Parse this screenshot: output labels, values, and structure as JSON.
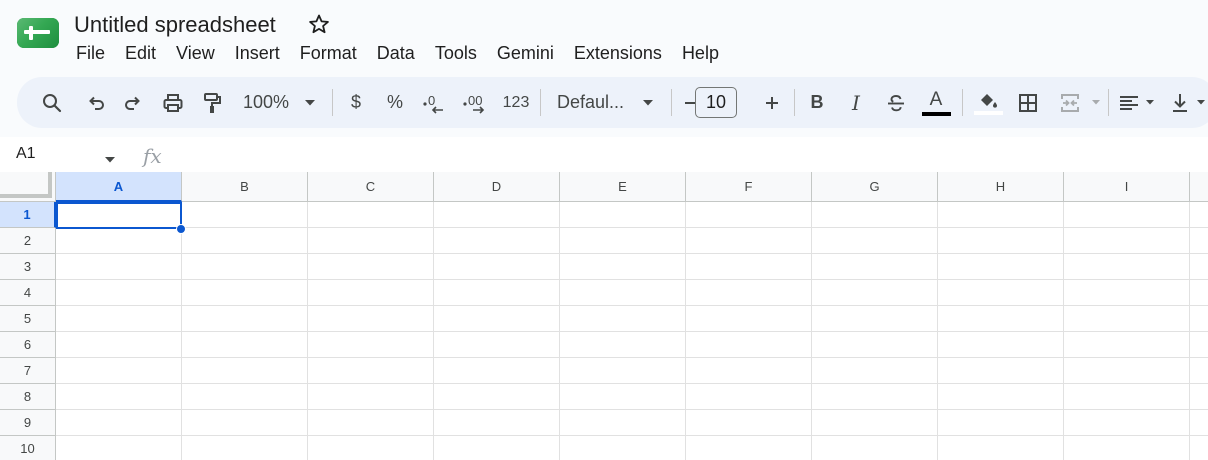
{
  "app": {
    "document_title": "Untitled spreadsheet",
    "brand_color": "#1e8e3e",
    "accent_color": "#0b57d0"
  },
  "menu": [
    "File",
    "Edit",
    "View",
    "Insert",
    "Format",
    "Data",
    "Tools",
    "Gemini",
    "Extensions",
    "Help"
  ],
  "toolbar": {
    "zoom": "100%",
    "currency_label": "$",
    "percent_label": "%",
    "more_formats_label": "123",
    "font_family": "Defaul...",
    "font_size": "10",
    "bold_label": "B",
    "italic_label": "I",
    "text_color_label": "A",
    "icons": [
      "search-icon",
      "undo-icon",
      "redo-icon",
      "print-icon",
      "paint-format-icon",
      "decrease-decimal-icon",
      "increase-decimal-icon",
      "minus-icon",
      "plus-icon",
      "strikethrough-icon",
      "fill-color-icon",
      "borders-icon",
      "merge-cells-icon",
      "align-left-icon",
      "vertical-align-icon"
    ]
  },
  "formula_bar": {
    "name_box": "A1",
    "fx_label": "fx",
    "value": ""
  },
  "grid": {
    "columns": [
      "A",
      "B",
      "C",
      "D",
      "E",
      "F",
      "G",
      "H",
      "I"
    ],
    "rows": [
      "1",
      "2",
      "3",
      "4",
      "5",
      "6",
      "7",
      "8",
      "9",
      "10"
    ],
    "selected_cell": "A1"
  }
}
